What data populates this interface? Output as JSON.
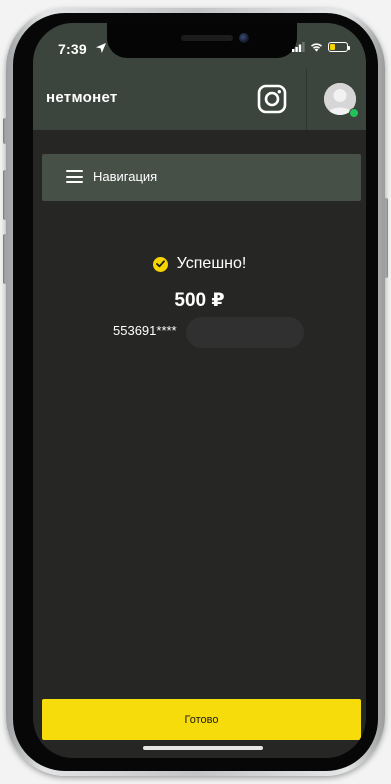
{
  "status_bar": {
    "time": "7:39"
  },
  "header": {
    "logo_text": "нетмонет"
  },
  "navigation": {
    "label": "Навигация"
  },
  "result": {
    "status_text": "Успешно!",
    "amount": "500 ₽",
    "card_number_visible": "553691****"
  },
  "actions": {
    "done_label": "Готово"
  },
  "colors": {
    "accent": "#f5dc0a",
    "header_bg": "#3b453e",
    "nav_bg": "#465047",
    "screen_bg": "#262624",
    "online_dot": "#24c15a"
  },
  "icons": {
    "location": "location-arrow-icon",
    "signal": "cellular-signal-icon",
    "wifi": "wifi-icon",
    "battery": "battery-icon",
    "instagram": "instagram-icon",
    "avatar": "user-avatar-icon",
    "menu": "hamburger-menu-icon",
    "success": "check-circle-icon"
  }
}
